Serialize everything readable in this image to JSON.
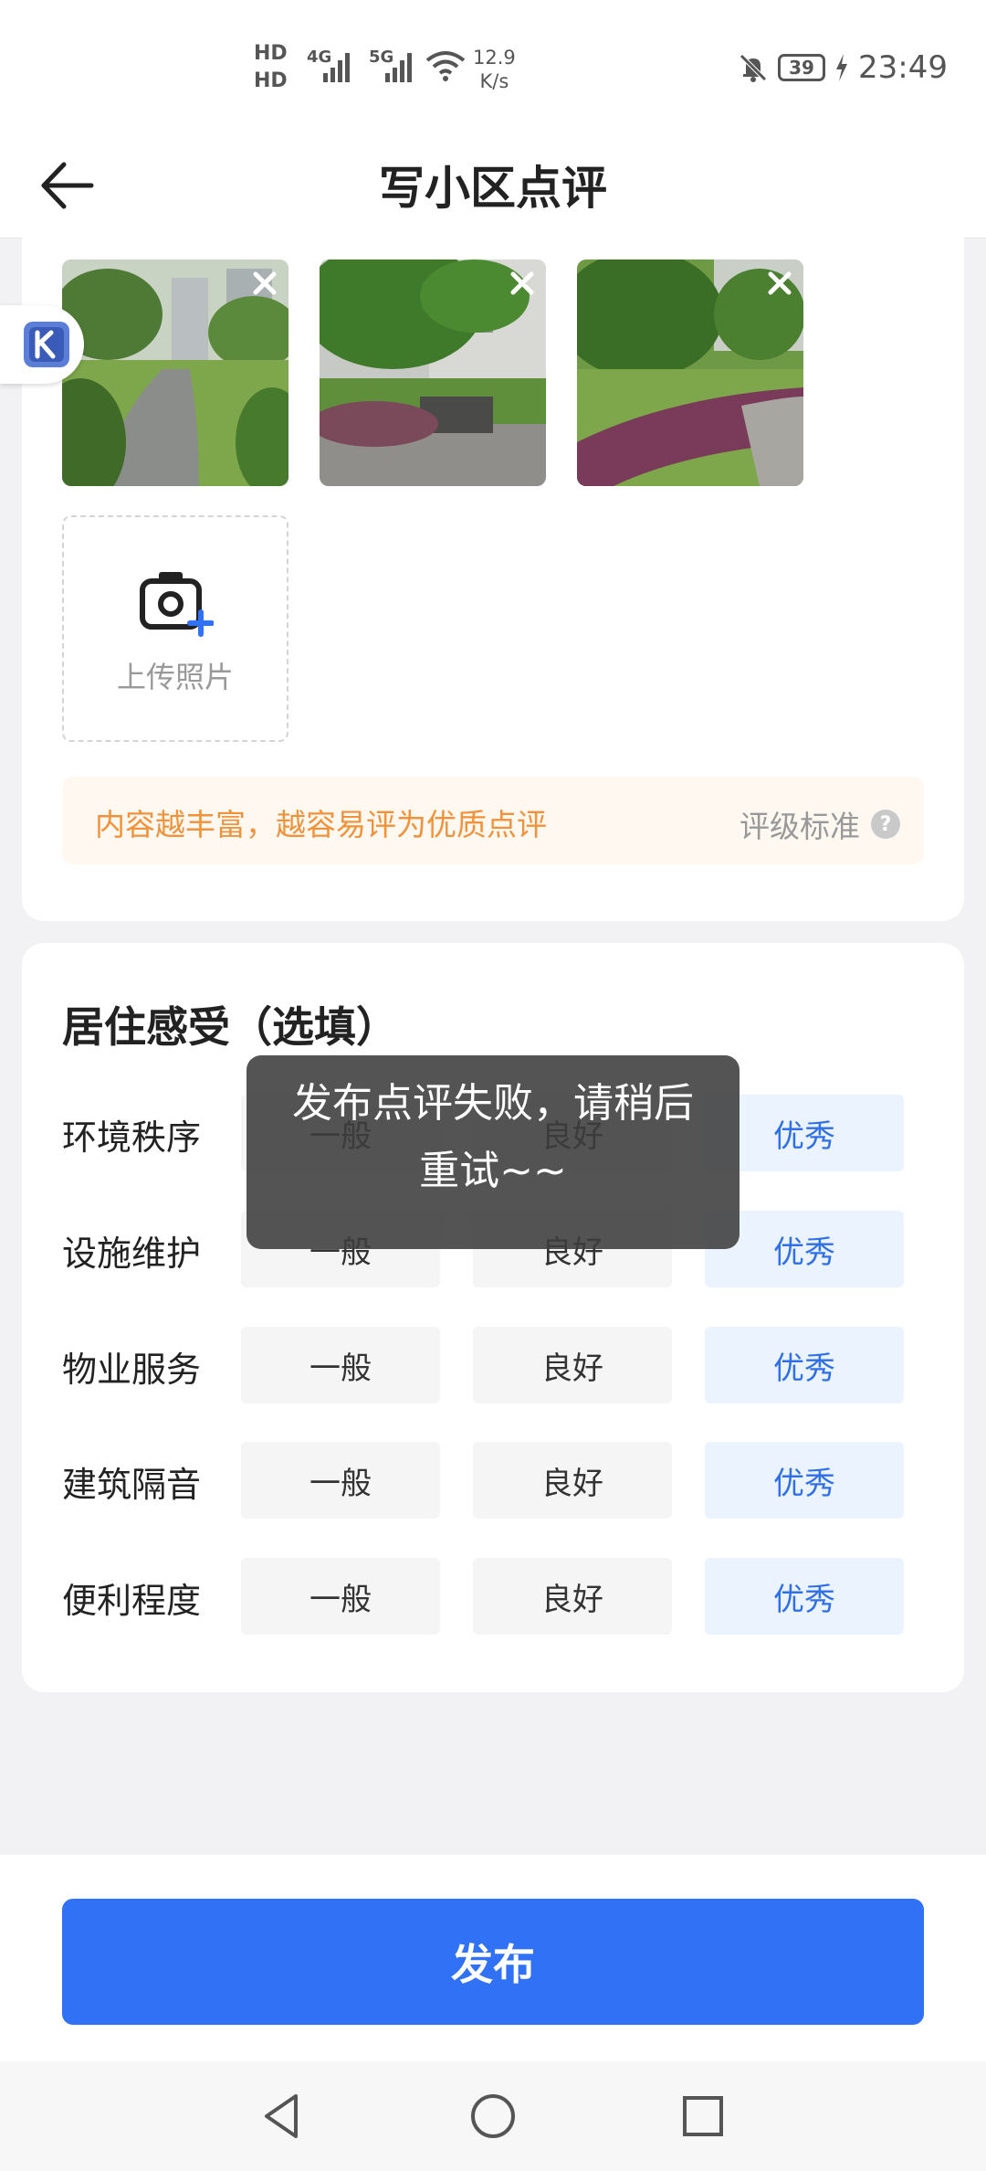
{
  "status_bar": {
    "hd1": "HD",
    "hd2": "HD",
    "net1": "4G",
    "net2": "5G",
    "speed_value": "12.9",
    "speed_unit": "K/s",
    "battery": "39",
    "time": "23:49"
  },
  "header": {
    "title": "写小区点评",
    "back_icon": "arrow-left-icon"
  },
  "photos": [
    {
      "scene": "wet garden path with lawn"
    },
    {
      "scene": "bench in front of building with trees"
    },
    {
      "scene": "curved flower bed with purple plants"
    }
  ],
  "upload": {
    "label": "上传照片",
    "icon": "camera-plus-icon"
  },
  "tip": {
    "text": "内容越丰富，越容易评为优质点评",
    "link": "评级标准",
    "help_icon": "?"
  },
  "living": {
    "title": "居住感受（选填）",
    "options": [
      "一般",
      "良好",
      "优秀"
    ],
    "rows": [
      {
        "label": "环境秩序",
        "selected": "优秀"
      },
      {
        "label": "设施维护",
        "selected": "优秀"
      },
      {
        "label": "物业服务",
        "selected": "优秀"
      },
      {
        "label": "建筑隔音",
        "selected": "优秀"
      },
      {
        "label": "便利程度",
        "selected": "优秀"
      }
    ]
  },
  "toast": {
    "text": "发布点评失败，请稍后重试~~"
  },
  "publish": {
    "label": "发布"
  },
  "colors": {
    "primary": "#3171f5",
    "selected_text": "#2f6fe8",
    "selected_bg": "#ebf3fe",
    "tip_text": "#f0923a",
    "tip_bg": "#fff8f1"
  },
  "nav_bar": [
    "back-triangle-icon",
    "home-circle-icon",
    "recents-square-icon"
  ]
}
